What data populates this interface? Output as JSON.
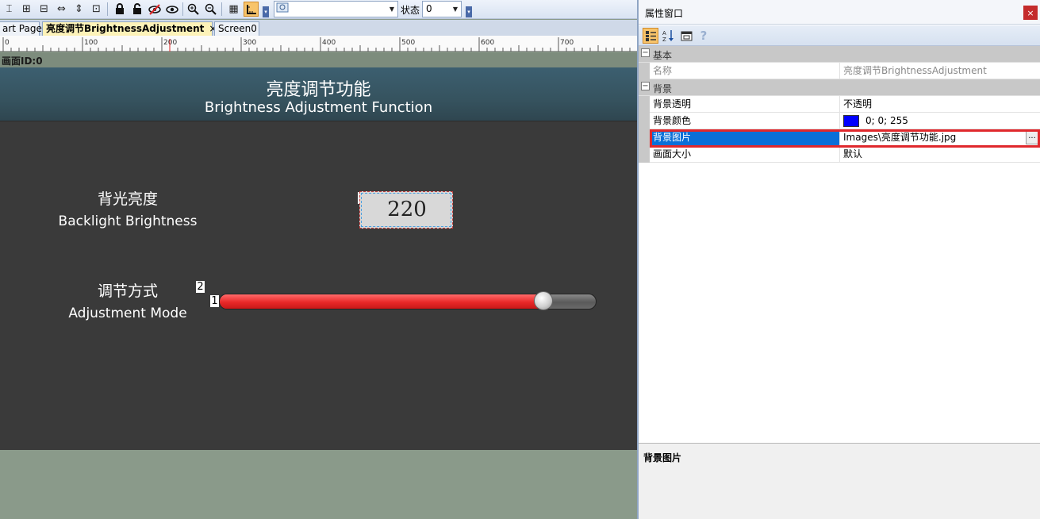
{
  "toolbar": {
    "icons": [
      "align-top-icon",
      "align-middle-icon",
      "align-stretch-icon",
      "same-width-icon",
      "same-height-icon",
      "same-size-icon",
      "lock-icon",
      "unlock-icon",
      "hide-icon",
      "show-icon",
      "zoom-in-icon",
      "zoom-out-icon",
      "grid-icon",
      "ruler-icon"
    ],
    "state_label": "状态",
    "state_value": "0",
    "screen_combo_value": ""
  },
  "tabs": [
    {
      "label": "art Page",
      "active": false
    },
    {
      "label": "亮度调节BrightnessAdjustment",
      "active": true,
      "close": "×"
    },
    {
      "label": "Screen0",
      "active": false
    }
  ],
  "ruler": {
    "marks": [
      "0",
      "100",
      "200",
      "300",
      "400",
      "500",
      "600",
      "700"
    ]
  },
  "screen_id": "画面ID:0",
  "hmi": {
    "title_cn": "亮度调节功能",
    "title_en": "Brightness Adjustment Function",
    "backlight_cn": "背光亮度",
    "backlight_en": "Backlight Brightness",
    "mode_cn": "调节方式",
    "mode_en": "Adjustment Mode",
    "numeric_value": "220",
    "slider_fraction": 0.86,
    "object_ids": {
      "slider": "1",
      "mode_label": "2",
      "numeric": "3"
    }
  },
  "properties": {
    "window_title": "属性窗口",
    "close": "×",
    "toolbar_icons": [
      "categorized-icon",
      "sort-alpha-icon",
      "property-pages-icon",
      "help-icon"
    ],
    "help_glyph": "?",
    "categories": [
      {
        "label": "基本",
        "toggle": "−",
        "rows": [
          {
            "name": "名称",
            "value": "亮度调节BrightnessAdjustment",
            "disabled": true
          }
        ]
      },
      {
        "label": "背景",
        "toggle": "−",
        "rows": [
          {
            "name": "背景透明",
            "value": "不透明"
          },
          {
            "name": "背景颜色",
            "value": "0; 0; 255",
            "swatch": "#0000ff"
          },
          {
            "name": "背景图片",
            "value": "Images\\亮度调节功能.jpg",
            "selected": true,
            "browse": "..."
          },
          {
            "name": "画面大小",
            "value": "默认"
          }
        ]
      }
    ],
    "description_title": "背景图片"
  },
  "colors": {
    "accent_selected": "#0a6fd8",
    "highlight": "#e0282c",
    "slider_fill": "#e82828",
    "canvas": "#3a3a3a"
  }
}
